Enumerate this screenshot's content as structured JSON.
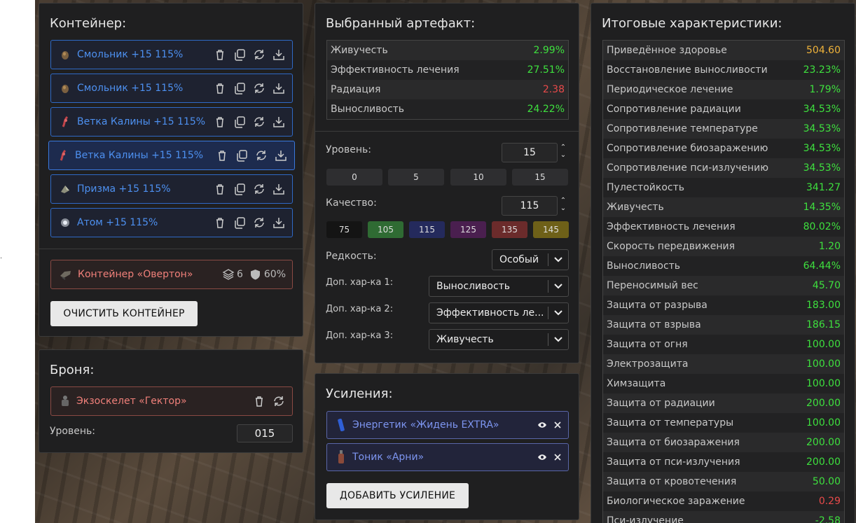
{
  "container": {
    "title": "Контейнер:",
    "items": [
      {
        "label": "Смольник +15 115%",
        "icon": "resin-artifact-icon"
      },
      {
        "label": "Смольник +15 115%",
        "icon": "resin-artifact-icon"
      },
      {
        "label": "Ветка Калины +15 115%",
        "icon": "branch-artifact-icon"
      },
      {
        "label": "Ветка Калины +15 115%",
        "icon": "branch-artifact-icon"
      },
      {
        "label": "Призма +15 115%",
        "icon": "prism-artifact-icon"
      },
      {
        "label": "Атом +15 115%",
        "icon": "atom-artifact-icon"
      }
    ],
    "container_name": "Контейнер «Овертон»",
    "slots": "6",
    "protection": "60%",
    "clear_label": "ОЧИСТИТЬ КОНТЕЙНЕР"
  },
  "armor": {
    "title": "Броня:",
    "name": "Экзоскелет «Гектор»",
    "level_label": "Уровень:",
    "level_value": "015"
  },
  "artifact": {
    "title": "Выбранный артефакт:",
    "stats": [
      {
        "label": "Живучесть",
        "value": "2.99%",
        "color": "#3ee03e"
      },
      {
        "label": "Эффективность лечения",
        "value": "27.51%",
        "color": "#3ee03e"
      },
      {
        "label": "Радиация",
        "value": "2.38",
        "color": "#e84a4a"
      },
      {
        "label": "Выносливость",
        "value": "24.22%",
        "color": "#3ee03e"
      }
    ],
    "level_label": "Уровень:",
    "level_value": "15",
    "level_presets": [
      "0",
      "5",
      "10",
      "15"
    ],
    "quality_label": "Качество:",
    "quality_value": "115",
    "quality_presets": [
      {
        "label": "75",
        "color": "#141414"
      },
      {
        "label": "105",
        "color": "#2f6b33"
      },
      {
        "label": "115",
        "color": "#242a5c"
      },
      {
        "label": "125",
        "color": "#4a1f4f"
      },
      {
        "label": "135",
        "color": "#6b2b2b"
      },
      {
        "label": "145",
        "color": "#6e6018"
      }
    ],
    "rarity_label": "Редкость:",
    "rarity_value": "Особый",
    "extra1_label": "Доп. хар-ка 1:",
    "extra1_value": "Выносливость",
    "extra2_label": "Доп. хар-ка 2:",
    "extra2_value": "Эффективность ле...",
    "extra3_label": "Доп. хар-ка 3:",
    "extra3_value": "Живучесть"
  },
  "boosts": {
    "title": "Усиления:",
    "items": [
      {
        "label": "Энергетик «Жидень EXTRA»"
      },
      {
        "label": "Тоник «Арни»"
      }
    ],
    "add_label": "ДОБАВИТЬ УСИЛЕНИЕ"
  },
  "totals": {
    "title": "Итоговые характеристики:",
    "stats": [
      {
        "label": "Приведённое здоровье",
        "value": "504.60",
        "color": "#f0b33a"
      },
      {
        "label": "Восстановление выносливости",
        "value": "23.23%",
        "color": "#3ee03e"
      },
      {
        "label": "Периодическое лечение",
        "value": "1.79%",
        "color": "#3ee03e"
      },
      {
        "label": "Сопротивление радиации",
        "value": "34.53%",
        "color": "#3ee03e"
      },
      {
        "label": "Сопротивление температуре",
        "value": "34.53%",
        "color": "#3ee03e"
      },
      {
        "label": "Сопротивление биозаражению",
        "value": "34.53%",
        "color": "#3ee03e"
      },
      {
        "label": "Сопротивление пси-излучению",
        "value": "34.53%",
        "color": "#3ee03e"
      },
      {
        "label": "Пулестойкость",
        "value": "341.27",
        "color": "#3ee03e"
      },
      {
        "label": "Живучесть",
        "value": "14.35%",
        "color": "#3ee03e"
      },
      {
        "label": "Эффективность лечения",
        "value": "80.02%",
        "color": "#3ee03e"
      },
      {
        "label": "Скорость передвижения",
        "value": "1.20",
        "color": "#3ee03e"
      },
      {
        "label": "Выносливость",
        "value": "64.44%",
        "color": "#3ee03e"
      },
      {
        "label": "Переносимый вес",
        "value": "45.70",
        "color": "#3ee03e"
      },
      {
        "label": "Защита от разрыва",
        "value": "183.00",
        "color": "#3ee03e"
      },
      {
        "label": "Защита от взрыва",
        "value": "186.15",
        "color": "#3ee03e"
      },
      {
        "label": "Защита от огня",
        "value": "100.00",
        "color": "#3ee03e"
      },
      {
        "label": "Электрозащита",
        "value": "100.00",
        "color": "#3ee03e"
      },
      {
        "label": "Химзащита",
        "value": "100.00",
        "color": "#3ee03e"
      },
      {
        "label": "Защита от радиации",
        "value": "200.00",
        "color": "#3ee03e"
      },
      {
        "label": "Защита от температуры",
        "value": "100.00",
        "color": "#3ee03e"
      },
      {
        "label": "Защита от биозаражения",
        "value": "200.00",
        "color": "#3ee03e"
      },
      {
        "label": "Защита от пси-излучения",
        "value": "200.00",
        "color": "#3ee03e"
      },
      {
        "label": "Защита от кровотечения",
        "value": "50.00",
        "color": "#3ee03e"
      },
      {
        "label": "Биологическое заражение",
        "value": "0.29",
        "color": "#e84a4a"
      },
      {
        "label": "Пси-излучение",
        "value": "-2.58",
        "color": "#3ee03e"
      }
    ]
  }
}
